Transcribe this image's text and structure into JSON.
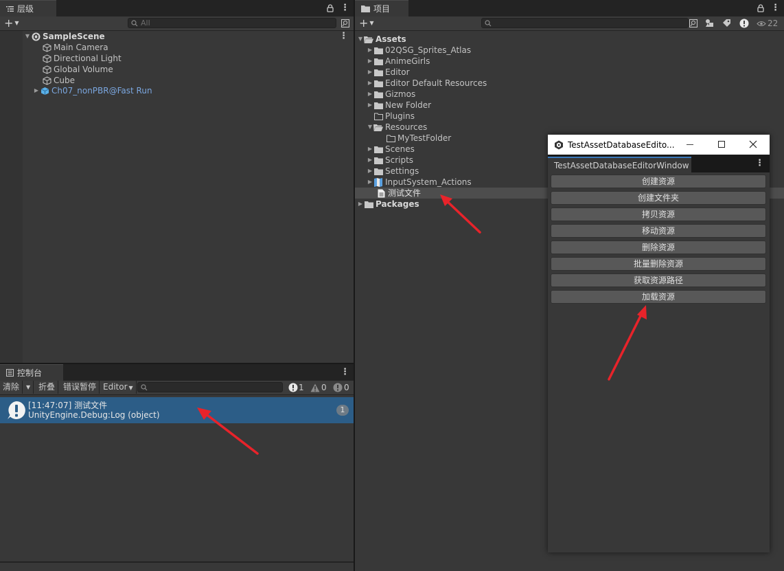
{
  "hierarchy": {
    "tab_label": "层级",
    "search_placeholder": "All",
    "scene_name": "SampleScene",
    "items": [
      {
        "label": "Main Camera"
      },
      {
        "label": "Directional Light"
      },
      {
        "label": "Global Volume"
      },
      {
        "label": "Cube"
      },
      {
        "label": "Ch07_nonPBR@Fast Run"
      }
    ]
  },
  "project": {
    "tab_label": "项目",
    "search_placeholder": "",
    "hidden_count": "22",
    "root": "Assets",
    "items": [
      {
        "label": "02QSG_Sprites_Atlas"
      },
      {
        "label": "AnimeGirls"
      },
      {
        "label": "Editor"
      },
      {
        "label": "Editor Default Resources"
      },
      {
        "label": "Gizmos"
      },
      {
        "label": "New Folder"
      },
      {
        "label": "Plugins"
      },
      {
        "label": "Resources"
      },
      {
        "label": "MyTestFolder"
      },
      {
        "label": "Scenes"
      },
      {
        "label": "Scripts"
      },
      {
        "label": "Settings"
      },
      {
        "label": "InputSystem_Actions"
      },
      {
        "label": "测试文件"
      }
    ],
    "packages": "Packages"
  },
  "console": {
    "tab_label": "控制台",
    "clear": "清除",
    "collapse": "折叠",
    "error_pause": "错误暂停",
    "editor": "Editor",
    "log_count": "1",
    "warn_count": "0",
    "error_count": "0",
    "entries": [
      {
        "line1": "[11:47:07] 测试文件",
        "line2": "UnityEngine.Debug:Log (object)",
        "count": "1"
      }
    ]
  },
  "editor_window": {
    "title": "TestAssetDatabaseEdito...",
    "tab_label": "TestAssetDatabaseEditorWindow",
    "buttons": [
      "创建资源",
      "创建文件夹",
      "拷贝资源",
      "移动资源",
      "删除资源",
      "批量删除资源",
      "获取资源路径",
      "加载资源"
    ]
  },
  "colors": {
    "selection": "#2c5d87",
    "accent": "#3a79bb",
    "arrow": "#e8232a"
  }
}
